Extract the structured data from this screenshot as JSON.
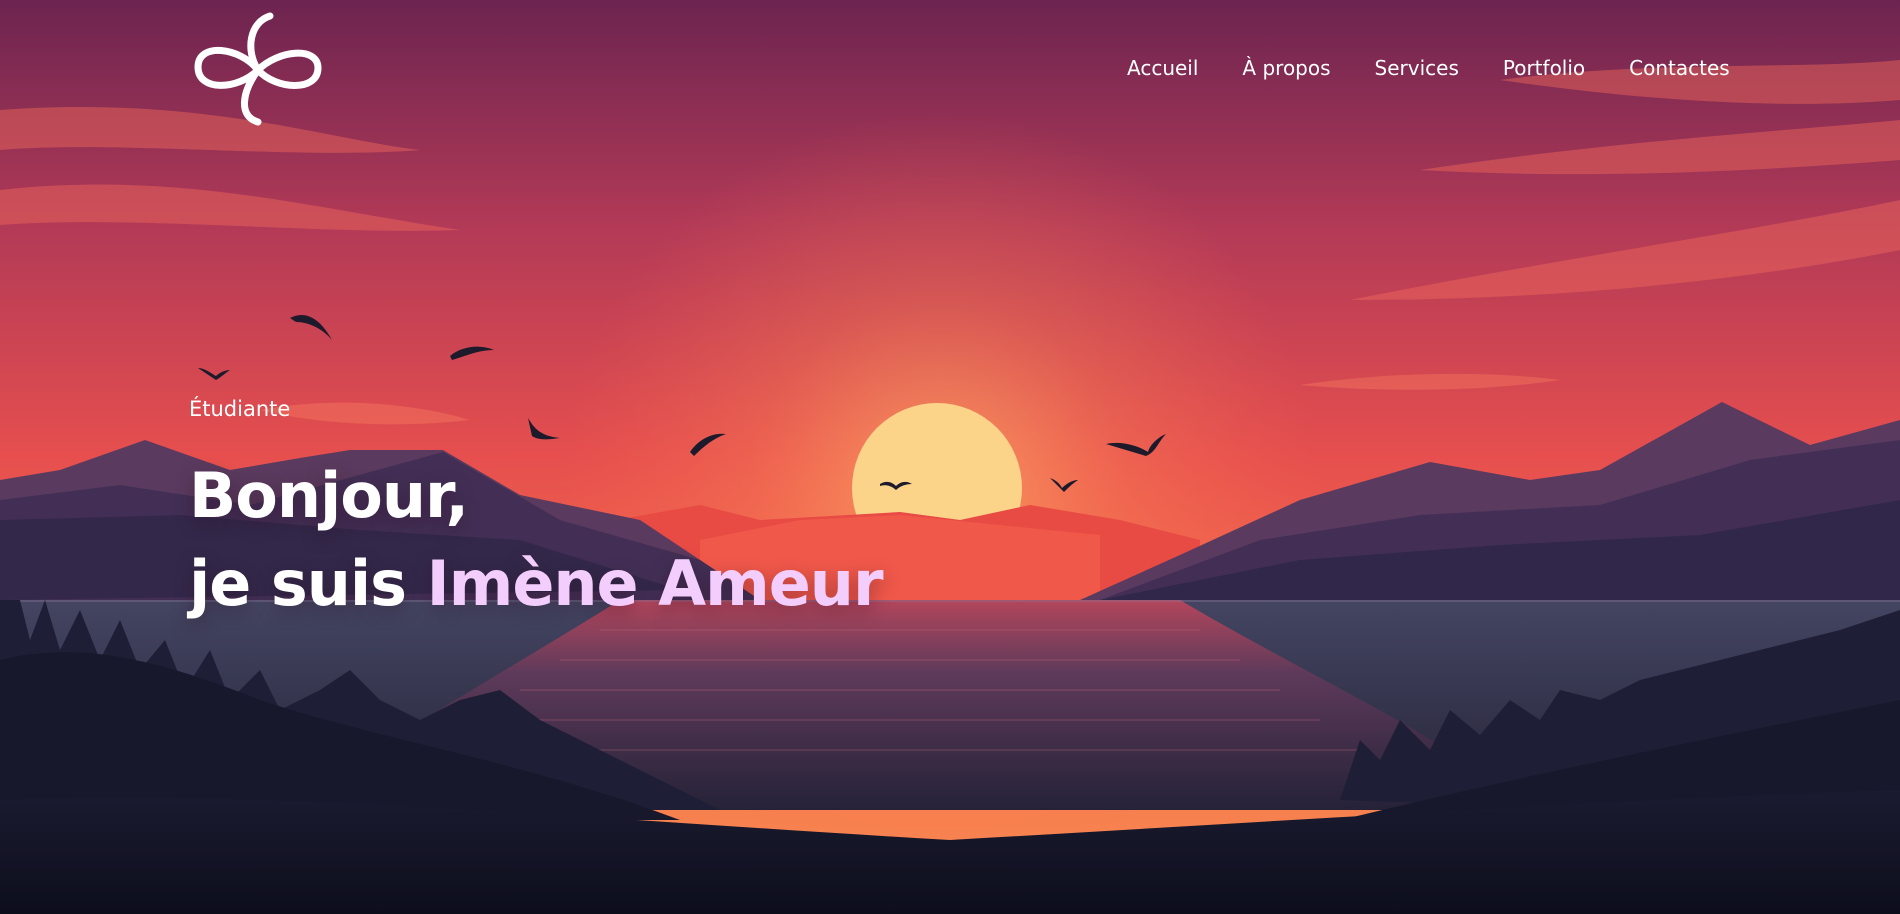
{
  "logo": {
    "icon": "infinity-knot-icon"
  },
  "nav": {
    "items": [
      {
        "label": "Accueil"
      },
      {
        "label": "À propos"
      },
      {
        "label": "Services"
      },
      {
        "label": "Portfolio"
      },
      {
        "label": "Contactes"
      }
    ]
  },
  "hero": {
    "subtitle": "Étudiante",
    "greeting": "Bonjour,",
    "intro": "je suis ",
    "name": "Imène Ameur"
  },
  "colors": {
    "sky_top": "#6e2450",
    "sky_mid": "#d9454f",
    "sky_horizon": "#f4704a",
    "sun": "#fbd389",
    "mountains": "#3c2a4e",
    "water": "#3a3350",
    "forest": "#141628",
    "accent_name": "#f3cdfb"
  }
}
